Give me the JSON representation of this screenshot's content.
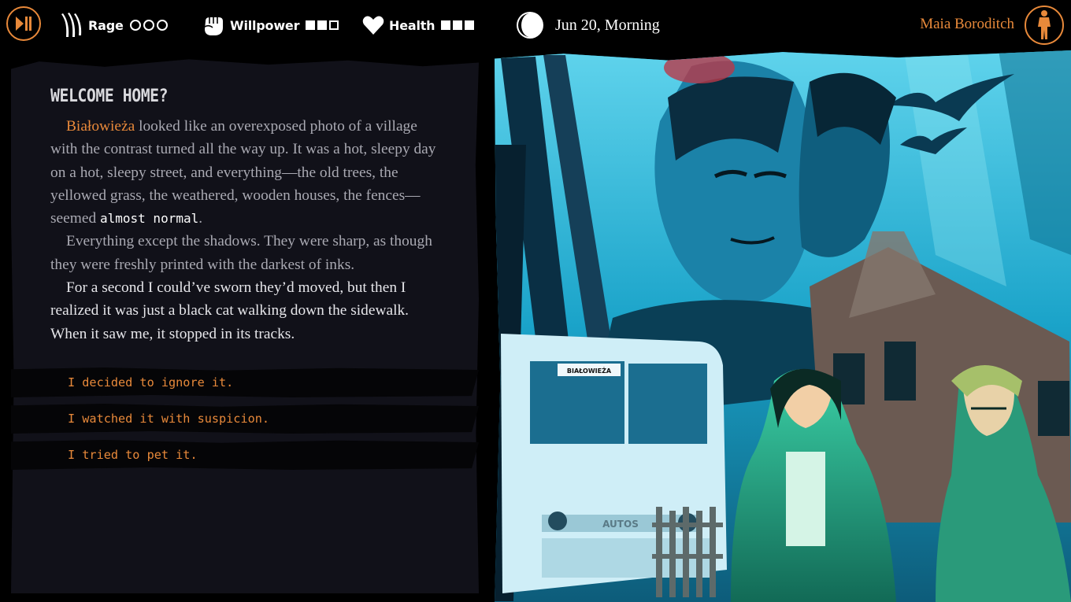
{
  "hud": {
    "menu_icon": "play-pause-icon",
    "rage": {
      "label": "Rage",
      "value": 0,
      "max": 3,
      "icon": "claw-marks-icon"
    },
    "willpower": {
      "label": "Willpower",
      "value": 2,
      "max": 3,
      "icon": "fist-icon"
    },
    "health": {
      "label": "Health",
      "value": 3,
      "max": 3,
      "icon": "heart-icon"
    },
    "moon_icon": "moon-phase-icon",
    "date": "Jun 20, Morning",
    "player_name": "Maia Boroditch",
    "avatar_icon": "character-silhouette-icon",
    "accent_color": "#e8893a"
  },
  "story": {
    "title": "WELCOME HOME?",
    "p1_place": "Białowieża",
    "p1_text": " looked like an overexposed photo of a village with the contrast turned all the way up. It was a hot, sleepy day on a hot, sleepy street, and everything—the old trees, the yellowed grass, the weathered, wooden houses, the fences—seemed ",
    "p1_emphasis": "almost normal",
    "p1_end": ".",
    "p2": "Everything except the shadows. They were sharp, as though they were freshly printed with the darkest of inks.",
    "p3": "For a second I could’ve sworn they’d moved, but then I realized it was just a black cat walking down the sidewalk. When it saw me, it stopped in its tracks."
  },
  "choices": [
    "I decided to ignore it.",
    "I watched it with suspicion.",
    "I tried to pet it."
  ],
  "art": {
    "bus_sign": "BIAŁOWIEŻA",
    "bus_badge": "AUTOS"
  }
}
